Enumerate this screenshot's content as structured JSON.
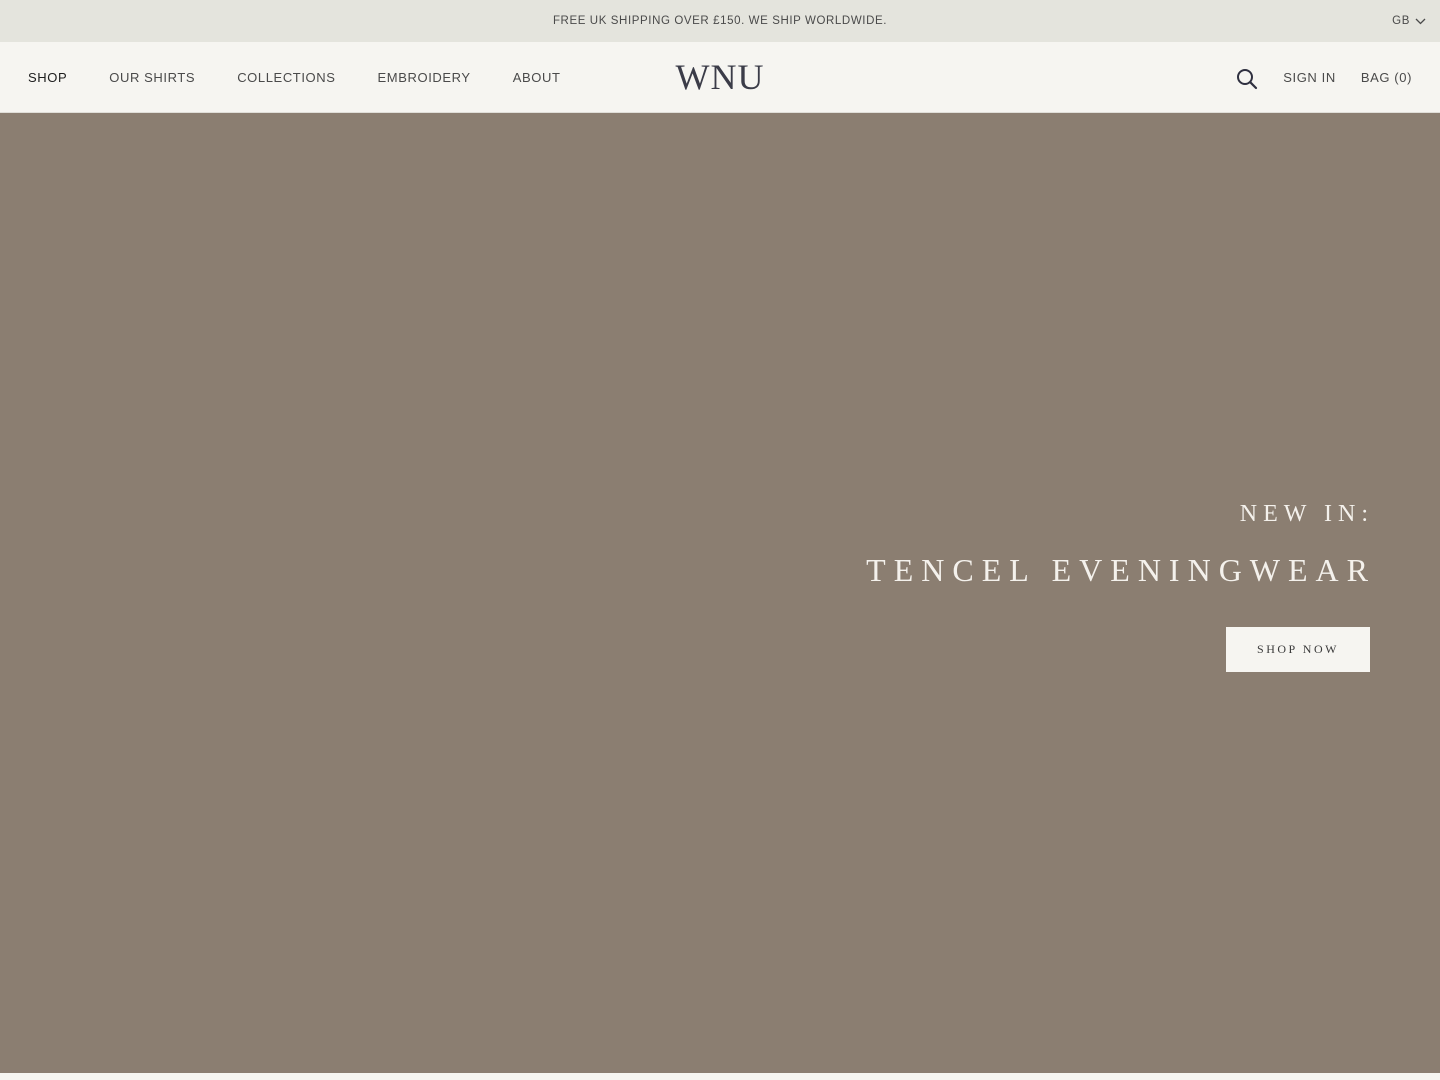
{
  "announcement": {
    "text": "FREE UK SHIPPING OVER £150. WE SHIP WORLDWIDE.",
    "country": "GB"
  },
  "header": {
    "logo": "WNU",
    "nav": [
      {
        "label": "SHOP"
      },
      {
        "label": "OUR SHIRTS"
      },
      {
        "label": "COLLECTIONS"
      },
      {
        "label": "EMBROIDERY"
      },
      {
        "label": "ABOUT"
      }
    ],
    "sign_in": "SIGN IN",
    "bag": "BAG (0)"
  },
  "hero": {
    "eyebrow": "NEW IN:",
    "title": "TENCEL EVENINGWEAR",
    "cta": "SHOP NOW"
  },
  "colors": {
    "announcement_bg": "#e4e4dd",
    "header_bg": "#f6f5f1",
    "hero_bg": "#8b7e71",
    "logo": "#3b3c48"
  },
  "icons": [
    "chevron-down-icon",
    "search-icon"
  ]
}
